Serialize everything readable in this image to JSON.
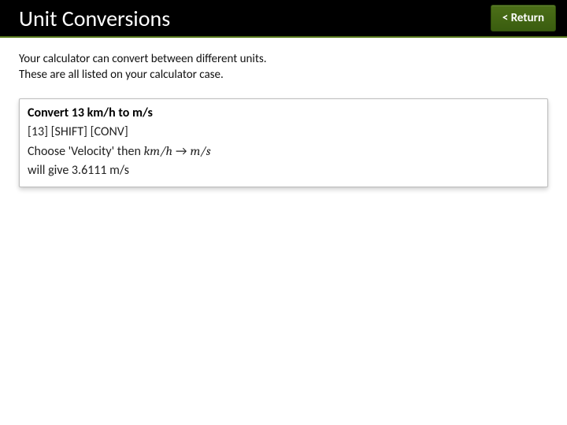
{
  "header": {
    "title": "Unit Conversions",
    "return_label": "< Return"
  },
  "intro": {
    "line1": "Your calculator can convert between different units.",
    "line2": "These are all listed on your calculator case."
  },
  "example": {
    "title": "Convert 13 km/h to m/s",
    "keys": "[13] [SHIFT] [CONV]",
    "choose_prefix": "Choose 'Velocity' then ",
    "from_unit": "km/h",
    "arrow": "→",
    "to_unit": "m/s",
    "result": "will give 3.6111 m/s"
  }
}
